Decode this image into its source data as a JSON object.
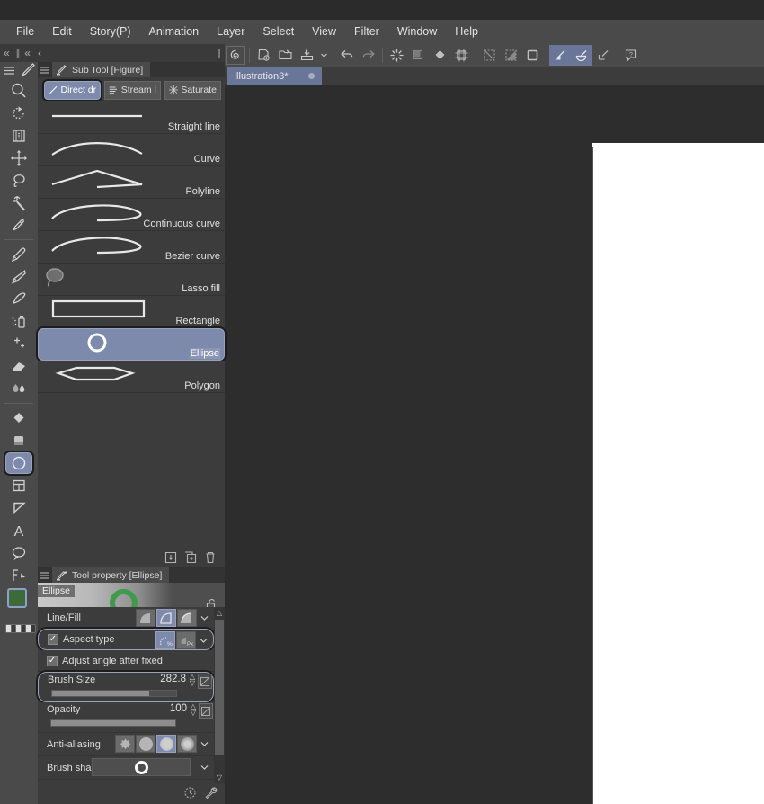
{
  "app": {
    "title_bar": "",
    "background_color": "#2d2d2d"
  },
  "menubar": {
    "items": [
      {
        "label": "File"
      },
      {
        "label": "Edit"
      },
      {
        "label": "Story(P)"
      },
      {
        "label": "Animation"
      },
      {
        "label": "Layer"
      },
      {
        "label": "Select"
      },
      {
        "label": "View"
      },
      {
        "label": "Filter"
      },
      {
        "label": "Window"
      },
      {
        "label": "Help"
      }
    ]
  },
  "command_bar": {
    "buttons": [
      {
        "name": "clip-studio-logo-icon",
        "selected": false,
        "boxed": true
      },
      {
        "name": "new-document-icon",
        "selected": false
      },
      {
        "name": "open-file-icon",
        "selected": false
      },
      {
        "name": "save-icon",
        "selected": false
      },
      {
        "name": "chevron-down-icon",
        "selected": false
      },
      {
        "name": "undo-icon",
        "selected": false
      },
      {
        "name": "redo-icon",
        "selected": false
      },
      {
        "name": "clear-icon",
        "selected": false
      },
      {
        "name": "fill-outside-selection-icon",
        "selected": false
      },
      {
        "name": "fill-icon",
        "selected": false
      },
      {
        "name": "crop-icon",
        "selected": false
      },
      {
        "name": "deselect-icon",
        "selected": false
      },
      {
        "name": "invert-selection-icon",
        "selected": false
      },
      {
        "name": "selection-border-icon",
        "selected": false
      },
      {
        "name": "shrink-selection-icon",
        "selected": true
      },
      {
        "name": "expand-selection-icon",
        "selected": true
      },
      {
        "name": "scale-selection-icon",
        "selected": false
      },
      {
        "name": "help-icon",
        "selected": false
      }
    ]
  },
  "document_tab": {
    "label": "Illustration3*",
    "modified_dot": true
  },
  "collapse_row": {
    "left_chevron": "«",
    "second_chevron": "«",
    "third_chevron": "‹"
  },
  "toolbar": {
    "tools": [
      {
        "name": "magnifier-tool",
        "label": "Zoom",
        "selected": false
      },
      {
        "name": "rotate-tool",
        "label": "Rotate",
        "selected": false
      },
      {
        "name": "move-layer-tool",
        "label": "Move layer",
        "selected": false
      },
      {
        "name": "move-tool",
        "label": "Operation",
        "selected": false
      },
      {
        "name": "lasso-select-tool",
        "label": "Selection",
        "selected": false
      },
      {
        "name": "auto-select-tool",
        "label": "Auto select",
        "selected": false
      },
      {
        "name": "eyedropper-tool",
        "label": "Eyedropper",
        "selected": false
      },
      {
        "name": "pen-tool",
        "label": "Pen",
        "selected": false
      },
      {
        "name": "pencil-tool",
        "label": "Pencil",
        "selected": false
      },
      {
        "name": "brush-tool",
        "label": "Brush",
        "selected": false
      },
      {
        "name": "airbrush-tool",
        "label": "Airbrush",
        "selected": false
      },
      {
        "name": "decoration-tool",
        "label": "Decoration",
        "selected": false
      },
      {
        "name": "eraser-tool",
        "label": "Eraser",
        "selected": false
      },
      {
        "name": "blend-tool",
        "label": "Blend",
        "selected": false
      },
      {
        "name": "gradient-tool",
        "label": "Gradient",
        "selected": false
      },
      {
        "name": "fill-tool",
        "label": "Fill",
        "selected": false
      },
      {
        "name": "figure-tool",
        "label": "Figure",
        "selected": true
      },
      {
        "name": "frame-border-tool",
        "label": "Frame border",
        "selected": false
      },
      {
        "name": "ruler-tool",
        "label": "Ruler",
        "selected": false
      },
      {
        "name": "text-tool",
        "label": "Text",
        "selected": false
      },
      {
        "name": "balloon-tool",
        "label": "Balloon",
        "selected": false
      },
      {
        "name": "correct-line-tool",
        "label": "Correct line",
        "selected": false
      }
    ],
    "colors": {
      "foreground": "#3c6b37",
      "background": "#f0a85a"
    }
  },
  "sub_tool_panel": {
    "tab_title": "Sub Tool [Figure]",
    "sub_tabs": [
      {
        "label": "Direct dr",
        "icon": "direct-draw-icon",
        "selected": true
      },
      {
        "label": "Stream l",
        "icon": "stream-line-icon",
        "selected": false
      },
      {
        "label": "Saturate",
        "icon": "saturate-line-icon",
        "selected": false
      }
    ],
    "items": [
      {
        "label": "Straight line",
        "art": "straight-line",
        "selected": false
      },
      {
        "label": "Curve",
        "art": "curve",
        "selected": false
      },
      {
        "label": "Polyline",
        "art": "polyline",
        "selected": false
      },
      {
        "label": "Continuous curve",
        "art": "continuous-curve",
        "selected": false
      },
      {
        "label": "Bezier curve",
        "art": "bezier-curve",
        "selected": false
      },
      {
        "label": "Lasso fill",
        "art": "lasso-fill",
        "selected": false
      },
      {
        "label": "Rectangle",
        "art": "rectangle",
        "selected": false
      },
      {
        "label": "Ellipse",
        "art": "ellipse",
        "selected": true
      },
      {
        "label": "Polygon",
        "art": "polygon",
        "selected": false
      }
    ],
    "footer_buttons": [
      {
        "name": "import-sub-tool-icon"
      },
      {
        "name": "duplicate-sub-tool-icon"
      },
      {
        "name": "delete-sub-tool-icon"
      }
    ]
  },
  "tool_property_panel": {
    "tab_title": "Tool property [Ellipse]",
    "preview_name": "Ellipse",
    "preview_ring_color": "#3f9a4e",
    "lock_icon": "unlock-icon",
    "rows": [
      {
        "name": "line-fill",
        "label": "Line/Fill",
        "options": [
          "fill-only",
          "line-and-fill",
          "line-only"
        ],
        "selected_index": 1,
        "has_dropdown": true,
        "highlighted": false
      },
      {
        "name": "aspect-type",
        "label": "Aspect type",
        "checked": true,
        "options": [
          "percent-aspect",
          "pixel-aspect"
        ],
        "selected_index": 0,
        "has_dropdown": true,
        "highlighted": true
      },
      {
        "name": "adjust-angle-after-fixed",
        "label": "Adjust angle after fixed",
        "checked": true,
        "highlighted": false
      },
      {
        "name": "brush-size",
        "label": "Brush Size",
        "value": "282.8",
        "slider_percent": 78,
        "highlighted": true
      },
      {
        "name": "opacity",
        "label": "Opacity",
        "value": "100",
        "slider_percent": 100,
        "highlighted": false
      },
      {
        "name": "anti-aliasing",
        "label": "Anti-aliasing",
        "options": [
          "none",
          "weak",
          "medium",
          "strong"
        ],
        "selected_index": 2,
        "has_dropdown": true,
        "highlighted": false
      },
      {
        "name": "brush-shape",
        "label": "Brush shape",
        "has_dropdown": true,
        "highlighted": false
      }
    ],
    "footer_buttons": [
      {
        "name": "reset-to-default-icon"
      },
      {
        "name": "tool-settings-wrench-icon"
      }
    ]
  }
}
